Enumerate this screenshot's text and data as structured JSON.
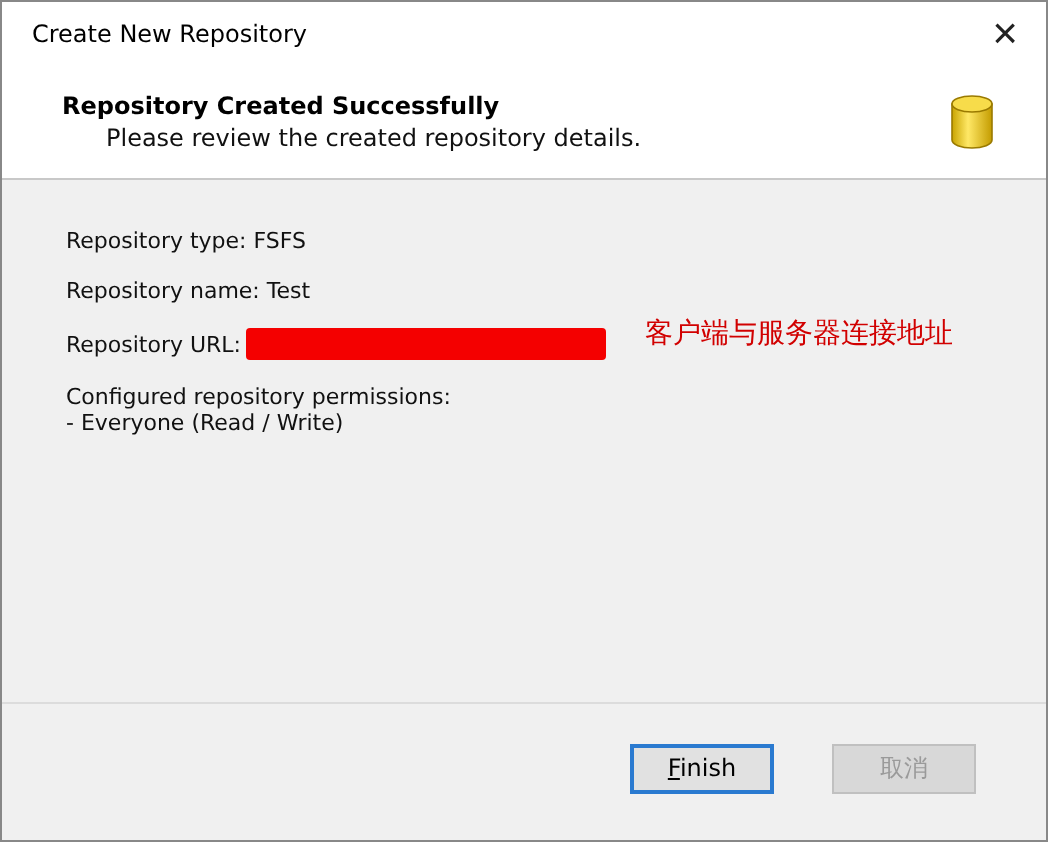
{
  "window": {
    "title": "Create New Repository",
    "close": "×"
  },
  "header": {
    "title": "Repository Created Successfully",
    "subtitle": "Please review the created repository details."
  },
  "details": [
    {
      "kind": "line",
      "text": "Repository type: FSFS"
    },
    {
      "kind": "line",
      "text": "Repository name: Test"
    },
    {
      "kind": "url",
      "text": "Repository URL:",
      "note": "客户端与服务器连接地址"
    },
    {
      "kind": "block",
      "text": "Configured repository permissions:",
      "sub": "- Everyone (Read / Write)"
    }
  ],
  "buttons": [
    {
      "label": "Finish",
      "default": true,
      "disabled": false
    },
    {
      "label": "取消",
      "default": false,
      "disabled": true
    }
  ]
}
